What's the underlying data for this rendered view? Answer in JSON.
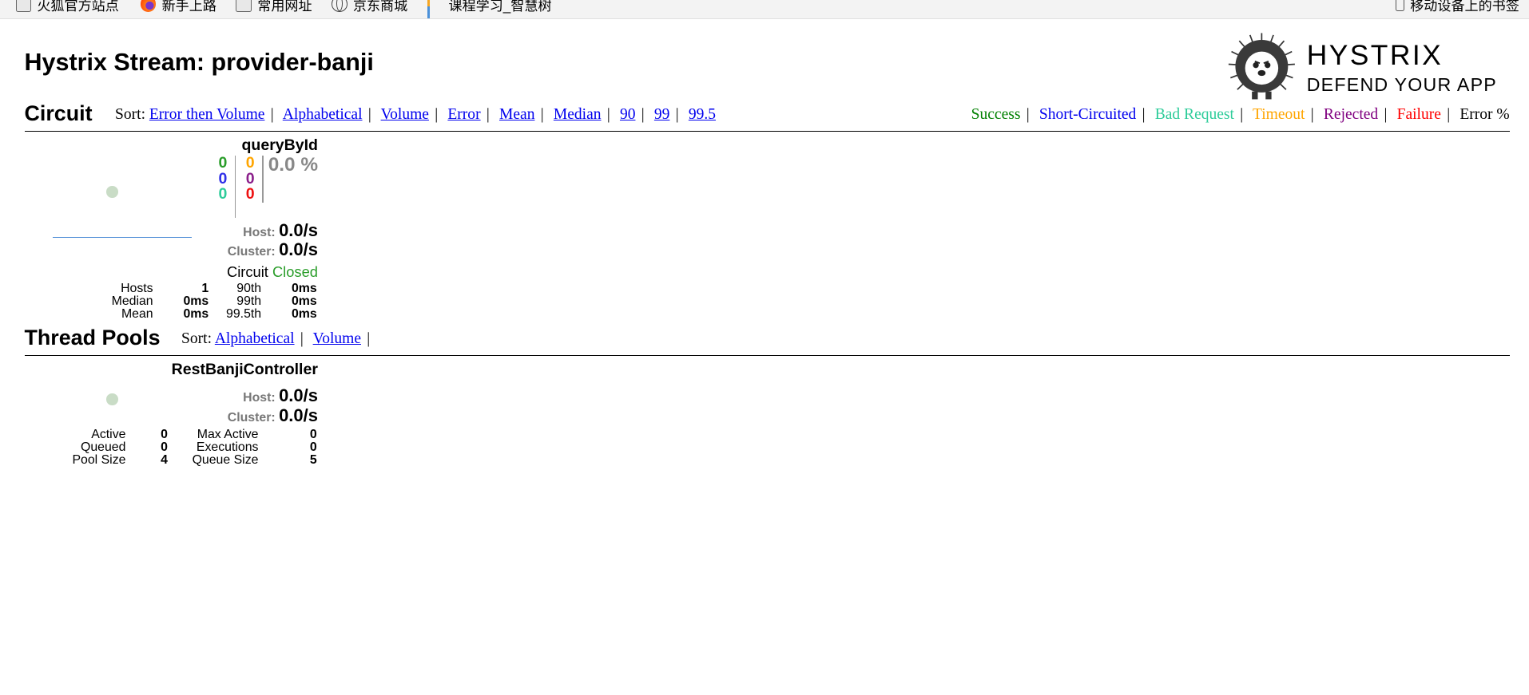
{
  "bookmarks": [
    {
      "label": "火狐官方站点",
      "icon": "folder-icon"
    },
    {
      "label": "新手上路",
      "icon": "firefox-icon"
    },
    {
      "label": "常用网址",
      "icon": "folder-icon"
    },
    {
      "label": "京东商城",
      "icon": "globe-icon"
    },
    {
      "label": "课程学习_智慧树",
      "icon": "bars-icon"
    }
  ],
  "bookmarks_right": {
    "label": "移动设备上的书签",
    "icon": "mobile-icon"
  },
  "page_title": "Hystrix Stream: provider-banji",
  "logo": {
    "line1": "HYSTRIX",
    "line2": "DEFEND YOUR APP"
  },
  "circuit_section": {
    "title": "Circuit",
    "sort_label": "Sort:",
    "sort_options": [
      "Error then Volume",
      "Alphabetical",
      "Volume",
      "Error",
      "Mean",
      "Median",
      "90",
      "99",
      "99.5"
    ],
    "legend": [
      {
        "label": "Success",
        "color": "#008000"
      },
      {
        "label": "Short-Circuited",
        "color": "#0000ee"
      },
      {
        "label": "Bad Request",
        "color": "#2ecc9a"
      },
      {
        "label": "Timeout",
        "color": "#ffa500"
      },
      {
        "label": "Rejected",
        "color": "#800080"
      },
      {
        "label": "Failure",
        "color": "#ff0000"
      },
      {
        "label": "Error %",
        "color": "#000000"
      }
    ]
  },
  "circuit": {
    "name": "queryById",
    "success": "0",
    "short_circuited": "0",
    "bad_request": "0",
    "timeout": "0",
    "rejected": "0",
    "failure": "0",
    "error_pct": "0.0 %",
    "host_label": "Host:",
    "host_rate": "0.0/s",
    "cluster_label": "Cluster:",
    "cluster_rate": "0.0/s",
    "circuit_label": "Circuit",
    "circuit_status": "Closed",
    "stats": {
      "hosts_label": "Hosts",
      "hosts": "1",
      "median_label": "Median",
      "median": "0ms",
      "mean_label": "Mean",
      "mean": "0ms",
      "p90_label": "90th",
      "p90": "0ms",
      "p99_label": "99th",
      "p99": "0ms",
      "p995_label": "99.5th",
      "p995": "0ms"
    }
  },
  "threadpool_section": {
    "title": "Thread Pools",
    "sort_label": "Sort:",
    "sort_options": [
      "Alphabetical",
      "Volume"
    ]
  },
  "threadpool": {
    "name": "RestBanjiController",
    "host_label": "Host:",
    "host_rate": "0.0/s",
    "cluster_label": "Cluster:",
    "cluster_rate": "0.0/s",
    "stats": {
      "active_label": "Active",
      "active": "0",
      "queued_label": "Queued",
      "queued": "0",
      "pool_size_label": "Pool Size",
      "pool_size": "4",
      "max_active_label": "Max Active",
      "max_active": "0",
      "executions_label": "Executions",
      "executions": "0",
      "queue_size_label": "Queue Size",
      "queue_size": "5"
    }
  }
}
